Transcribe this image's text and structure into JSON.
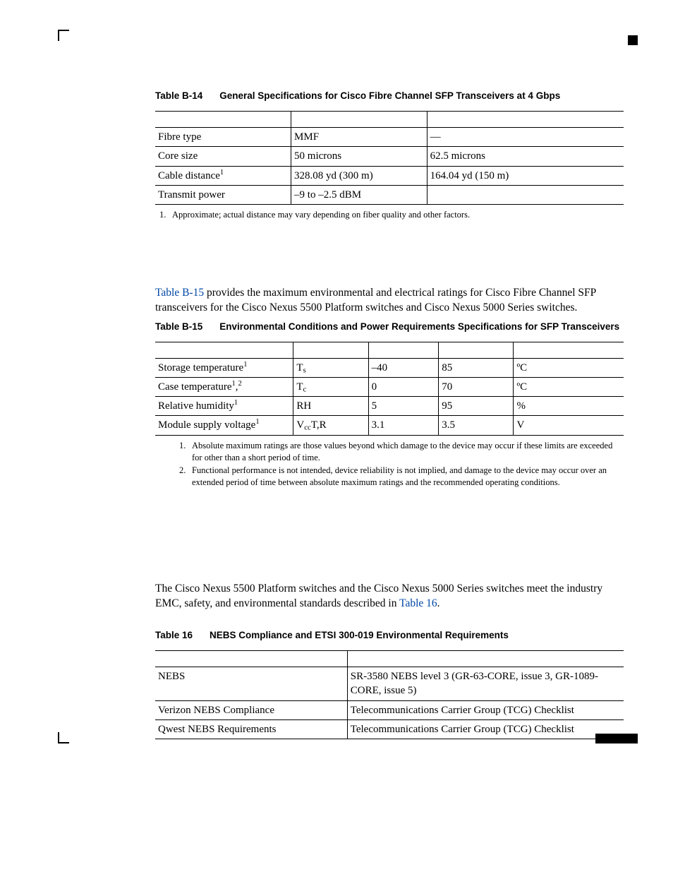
{
  "tableB14": {
    "labelNum": "Table B-14",
    "labelTitle": "General Specifications for Cisco Fibre Channel SFP Transceivers at 4 Gbps",
    "rows": [
      {
        "p": "Fibre type",
        "v1": "MMF",
        "v2": "—"
      },
      {
        "p": "Core size",
        "v1": "50 microns",
        "v2": "62.5 microns"
      },
      {
        "p": "Cable distance",
        "pSup": "1",
        "v1": "328.08 yd (300 m)",
        "v2": "164.04 yd (150 m)"
      },
      {
        "p": "Transmit power",
        "v1": "–9 to –2.5 dBM",
        "v2": ""
      }
    ],
    "footnotes": [
      {
        "n": "1.",
        "t": "Approximate; actual distance may vary depending on fiber quality and other factors."
      }
    ]
  },
  "paraB15_a": "Table B-15",
  "paraB15_b": " provides the maximum environmental and electrical ratings for Cisco Fibre Channel SFP transceivers for the Cisco Nexus 5500 Platform switches and Cisco Nexus 5000 Series switches.",
  "tableB15": {
    "labelNum": "Table B-15",
    "labelTitle": "Environmental Conditions and Power Requirements Specifications for SFP Transceivers",
    "rows": [
      {
        "p": "Storage temperature",
        "pSup": "1",
        "sym": "T",
        "symSub": "s",
        "min": "–40",
        "max": "85",
        "u": "ºC"
      },
      {
        "p": "Case temperature",
        "pSup": "1",
        "pSup2": "2",
        "sym": "T",
        "symSub": "c",
        "min": "0",
        "max": "70",
        "u": "ºC"
      },
      {
        "p": "Relative humidity",
        "pSup": "1",
        "sym": "RH",
        "min": "5",
        "max": "95",
        "u": "%"
      },
      {
        "p": "Module supply voltage",
        "pSup": "1",
        "sym": "V",
        "symSub": "cc",
        "symTail": "T,R",
        "min": "3.1",
        "max": "3.5",
        "u": "V"
      }
    ],
    "footnotes": [
      {
        "n": "1.",
        "t": "Absolute maximum ratings are those values beyond which damage to the device may occur if these limits are exceeded for other than a short period of time."
      },
      {
        "n": "2.",
        "t": "Functional performance is not intended, device reliability is not implied, and damage to the device may occur over an extended period of time between absolute maximum ratings and the recommended operating conditions."
      }
    ]
  },
  "para16_a": "The Cisco Nexus 5500 Platform switches and the Cisco Nexus 5000 Series switches meet the industry EMC, safety, and environmental standards described in ",
  "para16_link": "Table 16",
  "para16_b": ".",
  "table16": {
    "labelNum": "Table 16",
    "labelTitle": "NEBS Compliance and ETSI 300-019 Environmental Requirements",
    "rows": [
      {
        "p": "NEBS",
        "v": "SR-3580 NEBS level 3 (GR-63-CORE, issue 3, GR-1089-CORE, issue 5)"
      },
      {
        "p": "Verizon NEBS Compliance",
        "v": "Telecommunications Carrier Group (TCG) Checklist"
      },
      {
        "p": "Qwest NEBS Requirements",
        "v": "Telecommunications Carrier Group (TCG) Checklist"
      }
    ]
  }
}
